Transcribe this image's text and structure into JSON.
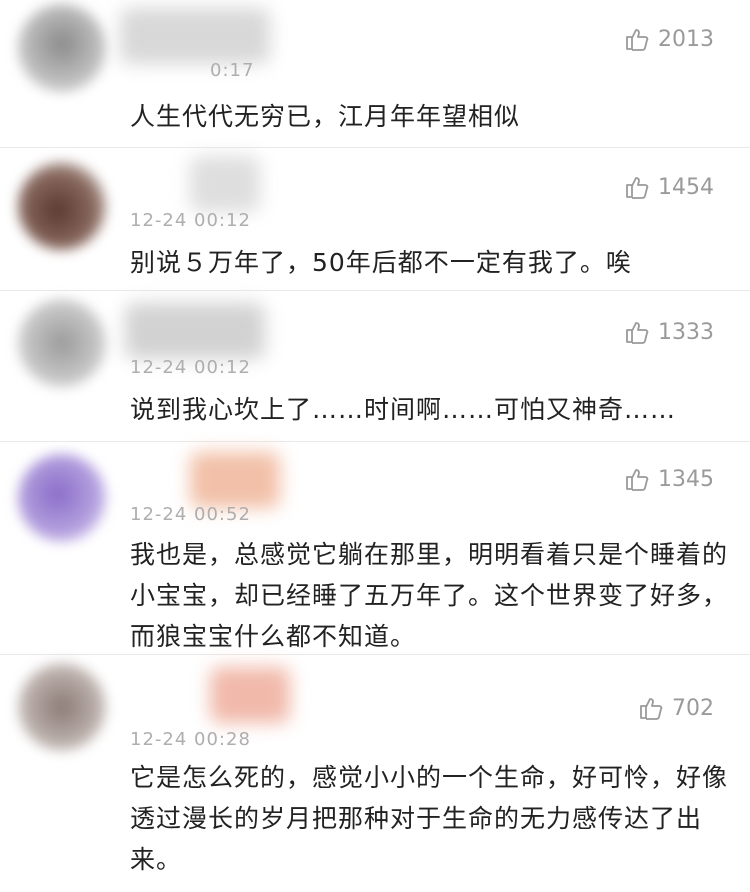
{
  "comments": [
    {
      "time": "0:17",
      "likes": "2013",
      "text": "人生代代无穷已，江月年年望相似"
    },
    {
      "time": "12-24 00:12",
      "likes": "1454",
      "text": "别说５万年了，50年后都不一定有我了。唉"
    },
    {
      "time": "12-24 00:12",
      "likes": "1333",
      "text": "说到我心坎上了……时间啊……可怕又神奇……"
    },
    {
      "time": "12-24 00:52",
      "likes": "1345",
      "text": "我也是，总感觉它躺在那里，明明看着只是个睡着的小宝宝，却已经睡了五万年了。这个世界变了好多，而狼宝宝什么都不知道。"
    },
    {
      "time": "12-24 00:28",
      "likes": "702",
      "text": "它是怎么死的，感觉小小的一个生命，好可怜，好像透过漫长的岁月把那种对于生命的无力感传达了出来。"
    }
  ],
  "icons": {
    "like": "thumbs-up-icon"
  }
}
